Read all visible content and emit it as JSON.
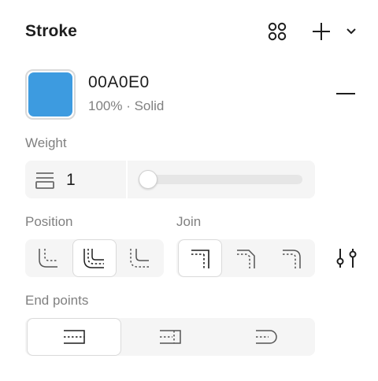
{
  "panel": {
    "title": "Stroke",
    "styles_icon": "styles-grid-icon",
    "add_icon": "plus-icon",
    "menu_icon": "chevron-down-icon"
  },
  "paint": {
    "hex": "00A0E0",
    "detail": "100% · Solid",
    "swatch_color": "#3d9be0",
    "remove_icon": "minus-icon"
  },
  "weight": {
    "label": "Weight",
    "value": "1",
    "slider_level": 0
  },
  "position": {
    "label": "Position",
    "options": [
      "inside",
      "center",
      "outside"
    ],
    "selected": "center"
  },
  "join": {
    "label": "Join",
    "options": [
      "miter",
      "bevel",
      "round"
    ],
    "selected": "miter",
    "advanced_icon": "sliders-icon"
  },
  "endpoints": {
    "label": "End points",
    "options": [
      "none",
      "square",
      "round"
    ],
    "selected": "none"
  }
}
